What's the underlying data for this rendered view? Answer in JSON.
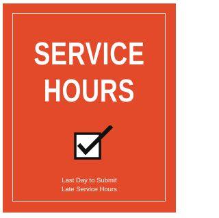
{
  "poster": {
    "title_line_1": "SERVICE",
    "title_line_2": "HOURS",
    "subtitle_line_1": "Last Day to Submit",
    "subtitle_line_2": "Late Service Hours",
    "icon": "checked-checkbox-icon",
    "colors": {
      "background": "#e34a2a",
      "text": "#ffffff",
      "checkbox_fill": "#ffffff",
      "check_mark": "#111111"
    }
  }
}
